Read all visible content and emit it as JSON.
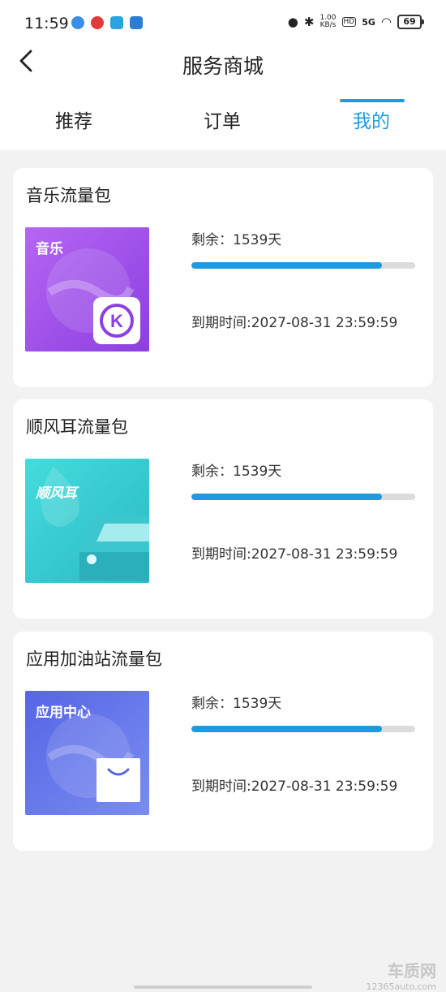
{
  "status_bar": {
    "time": "11:59",
    "net_speed_top": "1.00",
    "net_speed_unit": "KB/s",
    "hd": "HD",
    "signal": "5G",
    "battery": "69"
  },
  "header": {
    "title": "服务商城"
  },
  "tabs": [
    {
      "label": "推荐",
      "active": false
    },
    {
      "label": "订单",
      "active": false
    },
    {
      "label": "我的",
      "active": true
    }
  ],
  "packages": [
    {
      "name": "音乐流量包",
      "thumb_label": "音乐",
      "thumb_icon": "k-music-logo-icon",
      "remaining": "剩余：1539天",
      "remaining_fraction": 0.85,
      "expire": "到期时间:2027-08-31 23:59:59"
    },
    {
      "name": "顺风耳流量包",
      "thumb_label": "顺风耳",
      "thumb_icon": "car-icon",
      "remaining": "剩余：1539天",
      "remaining_fraction": 0.85,
      "expire": "到期时间:2027-08-31 23:59:59"
    },
    {
      "name": "应用加油站流量包",
      "thumb_label": "应用中心",
      "thumb_icon": "shopping-bag-icon",
      "remaining": "剩余：1539天",
      "remaining_fraction": 0.85,
      "expire": "到期时间:2027-08-31 23:59:59"
    }
  ],
  "watermark": {
    "brand": "车质网",
    "site": "12365auto.com"
  },
  "colors": {
    "accent": "#1e9be0",
    "music_gradient": [
      "#b05cf0",
      "#8a3fe0"
    ],
    "shunfenger_gradient": [
      "#3fd4d4",
      "#2bb9c2"
    ],
    "app_center_gradient": [
      "#5a6fe8",
      "#7a8af0"
    ]
  }
}
